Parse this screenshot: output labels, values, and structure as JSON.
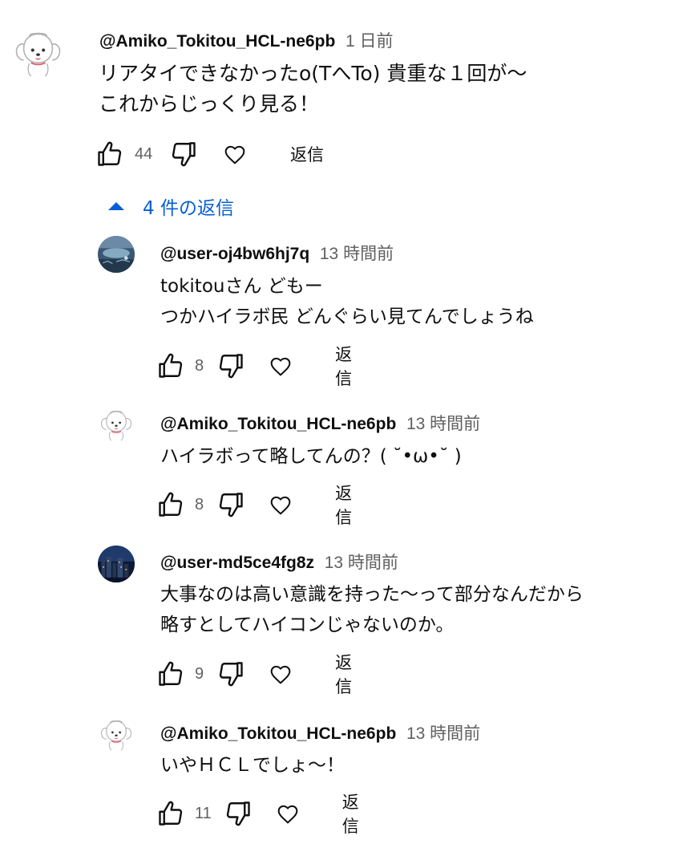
{
  "accent_color": "#065fd4",
  "comments": [
    {
      "author": "@Amiko_Tokitou_HCL-ne6pb",
      "time": "1 日前",
      "lines": [
        "リアタイできなかったo(TへTo) 貴重な１回が～",
        "これからじっくり見る！"
      ],
      "likes": "44",
      "reply_label": "返信",
      "avatar_icon": "dog-avatar-icon"
    }
  ],
  "replies_toggle": {
    "label": "4 件の返信",
    "icon": "caret-up-icon"
  },
  "replies": [
    {
      "author": "@user-oj4bw6hj7q",
      "time": "13 時間前",
      "lines": [
        "tokitouさん どもー",
        "つかハイラボ民 どんぐらい見てんでしょうね"
      ],
      "likes": "8",
      "reply_label": "返信",
      "avatar_icon": "aquarium-avatar-icon"
    },
    {
      "author": "@Amiko_Tokitou_HCL-ne6pb",
      "time": "13 時間前",
      "lines": [
        "ハイラボって略してんの？( ˘•ω•˘ )"
      ],
      "likes": "8",
      "reply_label": "返信",
      "avatar_icon": "dog-avatar-icon"
    },
    {
      "author": "@user-md5ce4fg8z",
      "time": "13 時間前",
      "lines": [
        "大事なのは高い意識を持った～って部分なんだから",
        "略すとしてハイコンじゃないのか。"
      ],
      "likes": "9",
      "reply_label": "返信",
      "avatar_icon": "night-city-avatar-icon"
    },
    {
      "author": "@Amiko_Tokitou_HCL-ne6pb",
      "time": "13 時間前",
      "lines": [
        "いやＨＣＬでしょ～！"
      ],
      "likes": "11",
      "reply_label": "返信",
      "avatar_icon": "dog-avatar-icon"
    }
  ]
}
